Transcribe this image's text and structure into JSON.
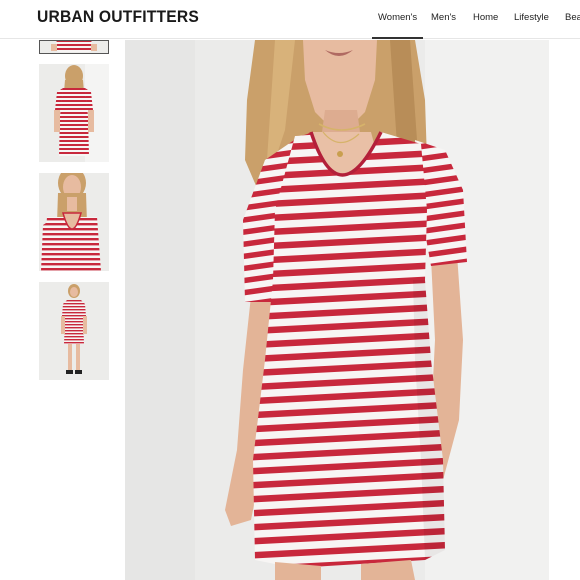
{
  "header": {
    "logo": "URBAN OUTFITTERS",
    "nav": [
      {
        "label": "Women's",
        "active": true
      },
      {
        "label": "Men's",
        "active": false
      },
      {
        "label": "Home",
        "active": false
      },
      {
        "label": "Lifestyle",
        "active": false
      },
      {
        "label": "Bea",
        "active": false
      }
    ]
  },
  "gallery": {
    "thumbnails": [
      {
        "icon": "product-photo-front-crop",
        "selected": true
      },
      {
        "icon": "product-photo-back",
        "selected": false
      },
      {
        "icon": "product-photo-neckline",
        "selected": false
      },
      {
        "icon": "product-photo-full-length",
        "selected": false
      }
    ],
    "main_icon": "product-photo-striped-dress"
  },
  "colors": {
    "stripe_red": "#c8283c",
    "stripe_white": "#f7f5f4",
    "skin": "#e7bba0",
    "hair": "#caa06a",
    "backdrop": "#ebebea"
  }
}
